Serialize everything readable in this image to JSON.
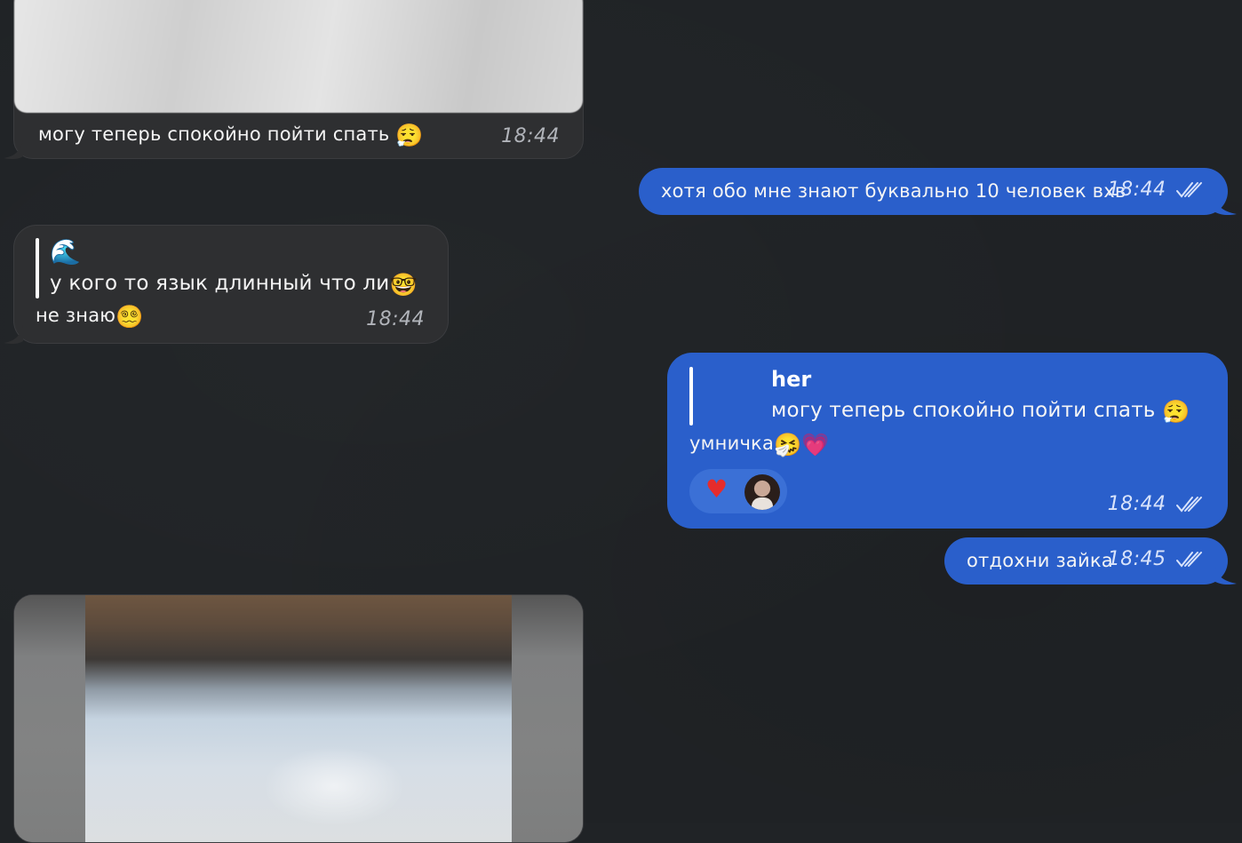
{
  "messages": {
    "photo_caption": {
      "text": "могу теперь спокойно пойти спать",
      "emoji": "😮‍💨",
      "time": "18:44"
    },
    "out_1": {
      "text": "хотя обо мне знают буквально 10 человек вхв",
      "time": "18:44",
      "status": "read"
    },
    "in_reply": {
      "quote_emoji": "🌊",
      "quote_text": "у кого то язык длинный что ли",
      "quote_text_emoji": "🤓",
      "text": "не знаю",
      "text_emoji": "😵‍💫",
      "time": "18:44"
    },
    "out_2": {
      "quote_author": "her",
      "quote_text": "могу теперь спокойно пойти спать",
      "quote_emoji": "😮‍💨",
      "text": "умничка",
      "text_emoji": "🤧💗",
      "reaction": "♥",
      "time": "18:44",
      "status": "read"
    },
    "out_3": {
      "text": "отдохни зайка",
      "time": "18:45",
      "status": "read"
    }
  },
  "colors": {
    "background": "#202326",
    "incoming_bubble": "#2e2f31",
    "outgoing_bubble": "#2a5fcb",
    "reaction_heart": "#e62c2c"
  },
  "icons": {
    "read_status": "double-check-icon",
    "reaction": "heart-icon"
  }
}
